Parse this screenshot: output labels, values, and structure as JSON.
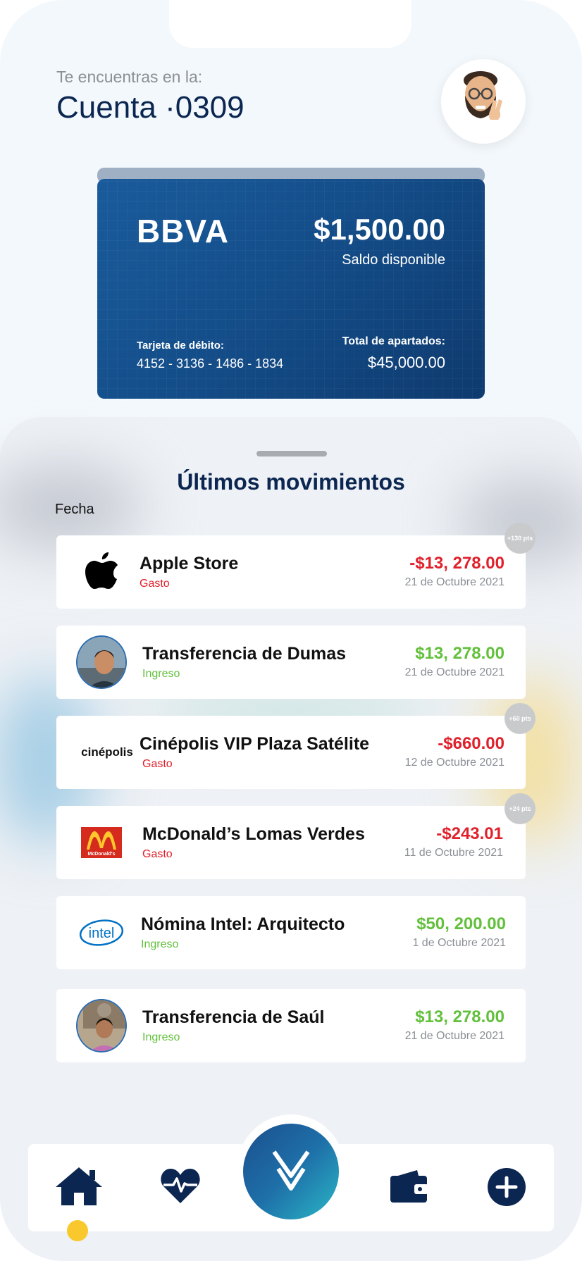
{
  "header": {
    "location_label": "Te encuentras en la:",
    "account_prefix": "Cuenta ",
    "account_number": "·0309",
    "avatar_icon": "memoji-avatar-icon"
  },
  "card": {
    "bank_name": "BBVA",
    "balance": "$1,500.00",
    "balance_label": "Saldo disponible",
    "debit_label": "Tarjeta de débito:",
    "debit_number": "4152 - 3136 - 1486 - 1834",
    "savings_label": "Total de apartados:",
    "savings_value": "$45,000.00"
  },
  "movements": {
    "title": "Últimos movimientos",
    "filter_label": "Fecha",
    "items": [
      {
        "title": "Apple Store",
        "kind": "Gasto",
        "amount": "-$13, 278.00",
        "date": "21 de Octubre 2021",
        "points": "+130 pts",
        "logo": "apple-logo-icon"
      },
      {
        "title": "Transferencia de Dumas",
        "kind": "Ingreso",
        "amount": "$13, 278.00",
        "date": "21 de Octubre 2021",
        "points": "",
        "logo": "person-photo"
      },
      {
        "title": "Cinépolis VIP Plaza Satélite",
        "kind": "Gasto",
        "amount": "-$660.00",
        "date": "12 de Octubre 2021",
        "points": "+60 pts",
        "logo": "cinepolis-logo",
        "logo_text": "cinépolis"
      },
      {
        "title": "McDonald’s Lomas Verdes",
        "kind": "Gasto",
        "amount": "-$243.01",
        "date": "11 de Octubre 2021",
        "points": "+24 pts",
        "logo": "mcdonalds-logo",
        "logo_text": "McDonald's"
      },
      {
        "title": "Nómina Intel: Arquitecto",
        "kind": "Ingreso",
        "amount": "$50, 200.00",
        "date": "1 de Octubre 2021",
        "points": "",
        "logo": "intel-logo",
        "logo_text": "intel"
      },
      {
        "title": "Transferencia de Saúl",
        "kind": "Ingreso",
        "amount": "$13, 278.00",
        "date": "21 de Octubre 2021",
        "points": "",
        "logo": "person-photo"
      }
    ]
  },
  "nav": {
    "items": [
      "home-icon",
      "heart-pulse-icon",
      "app-logo-icon",
      "wallet-icon",
      "plus-icon"
    ],
    "active": "home-icon"
  },
  "colors": {
    "navy": "#0b2650",
    "negative": "#e0202b",
    "positive": "#62c03c",
    "accent_dot": "#f9c82c",
    "card_blue": "#144e8a"
  }
}
